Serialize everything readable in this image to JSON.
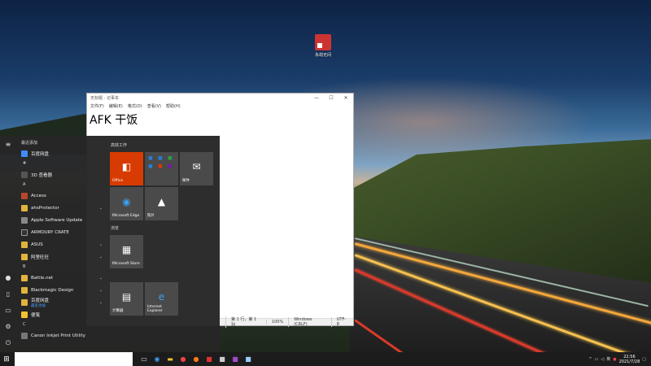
{
  "desktop": {
    "icon_label": "永劫无间"
  },
  "notepad": {
    "title": "无标题 - 记事本",
    "controls": [
      "—",
      "☐",
      "✕"
    ],
    "menu": [
      "文件(F)",
      "编辑(E)",
      "格式(O)",
      "查看(V)",
      "帮助(H)"
    ],
    "content": "AFK  干饭",
    "status": {
      "position": "第 1 行，第 1 列",
      "zoom": "100%",
      "line_ending": "Windows (CRLF)",
      "encoding": "UTF-8"
    }
  },
  "start_menu": {
    "recently_added": "最近添加",
    "apps": [
      {
        "label": "百度网盘",
        "color": "#3f8bff"
      },
      {
        "letter": "#"
      },
      {
        "label": "3D 查看器",
        "color": "#555"
      },
      {
        "letter": "A"
      },
      {
        "label": "Access",
        "color": "#b7472a"
      },
      {
        "label": "ahsProtector",
        "color": "#e2b33c",
        "folder": true
      },
      {
        "label": "Apple Software Update",
        "color": "#888"
      },
      {
        "label": "ARMOURY CRATE",
        "color": "#333"
      },
      {
        "label": "ASUS",
        "color": "#e2b33c",
        "folder": true
      },
      {
        "label": "阿里旺旺",
        "color": "#e2b33c",
        "folder": true
      },
      {
        "letter": "B"
      },
      {
        "label": "Battle.net",
        "color": "#e2b33c",
        "folder": true
      },
      {
        "label": "Blackmagic Design",
        "color": "#e2b33c",
        "folder": true
      },
      {
        "label": "百度网盘",
        "sub": "最近添加",
        "color": "#e2b33c",
        "folder": true
      },
      {
        "label": "便笺",
        "color": "#f2c230"
      },
      {
        "letter": "C"
      },
      {
        "label": "Canon Inkjet Print Utility",
        "color": "#777"
      }
    ],
    "groups": {
      "work": "高效工作",
      "browse": "浏览"
    },
    "tiles": {
      "office": "Office",
      "mail": "邮件",
      "edge": "Microsoft Edge",
      "photos": "照片",
      "store": "Microsoft Store",
      "calc": "计算器",
      "ie": "Internet Explorer"
    }
  },
  "taskbar": {
    "time": "22:56",
    "date": "2021/7/28"
  }
}
